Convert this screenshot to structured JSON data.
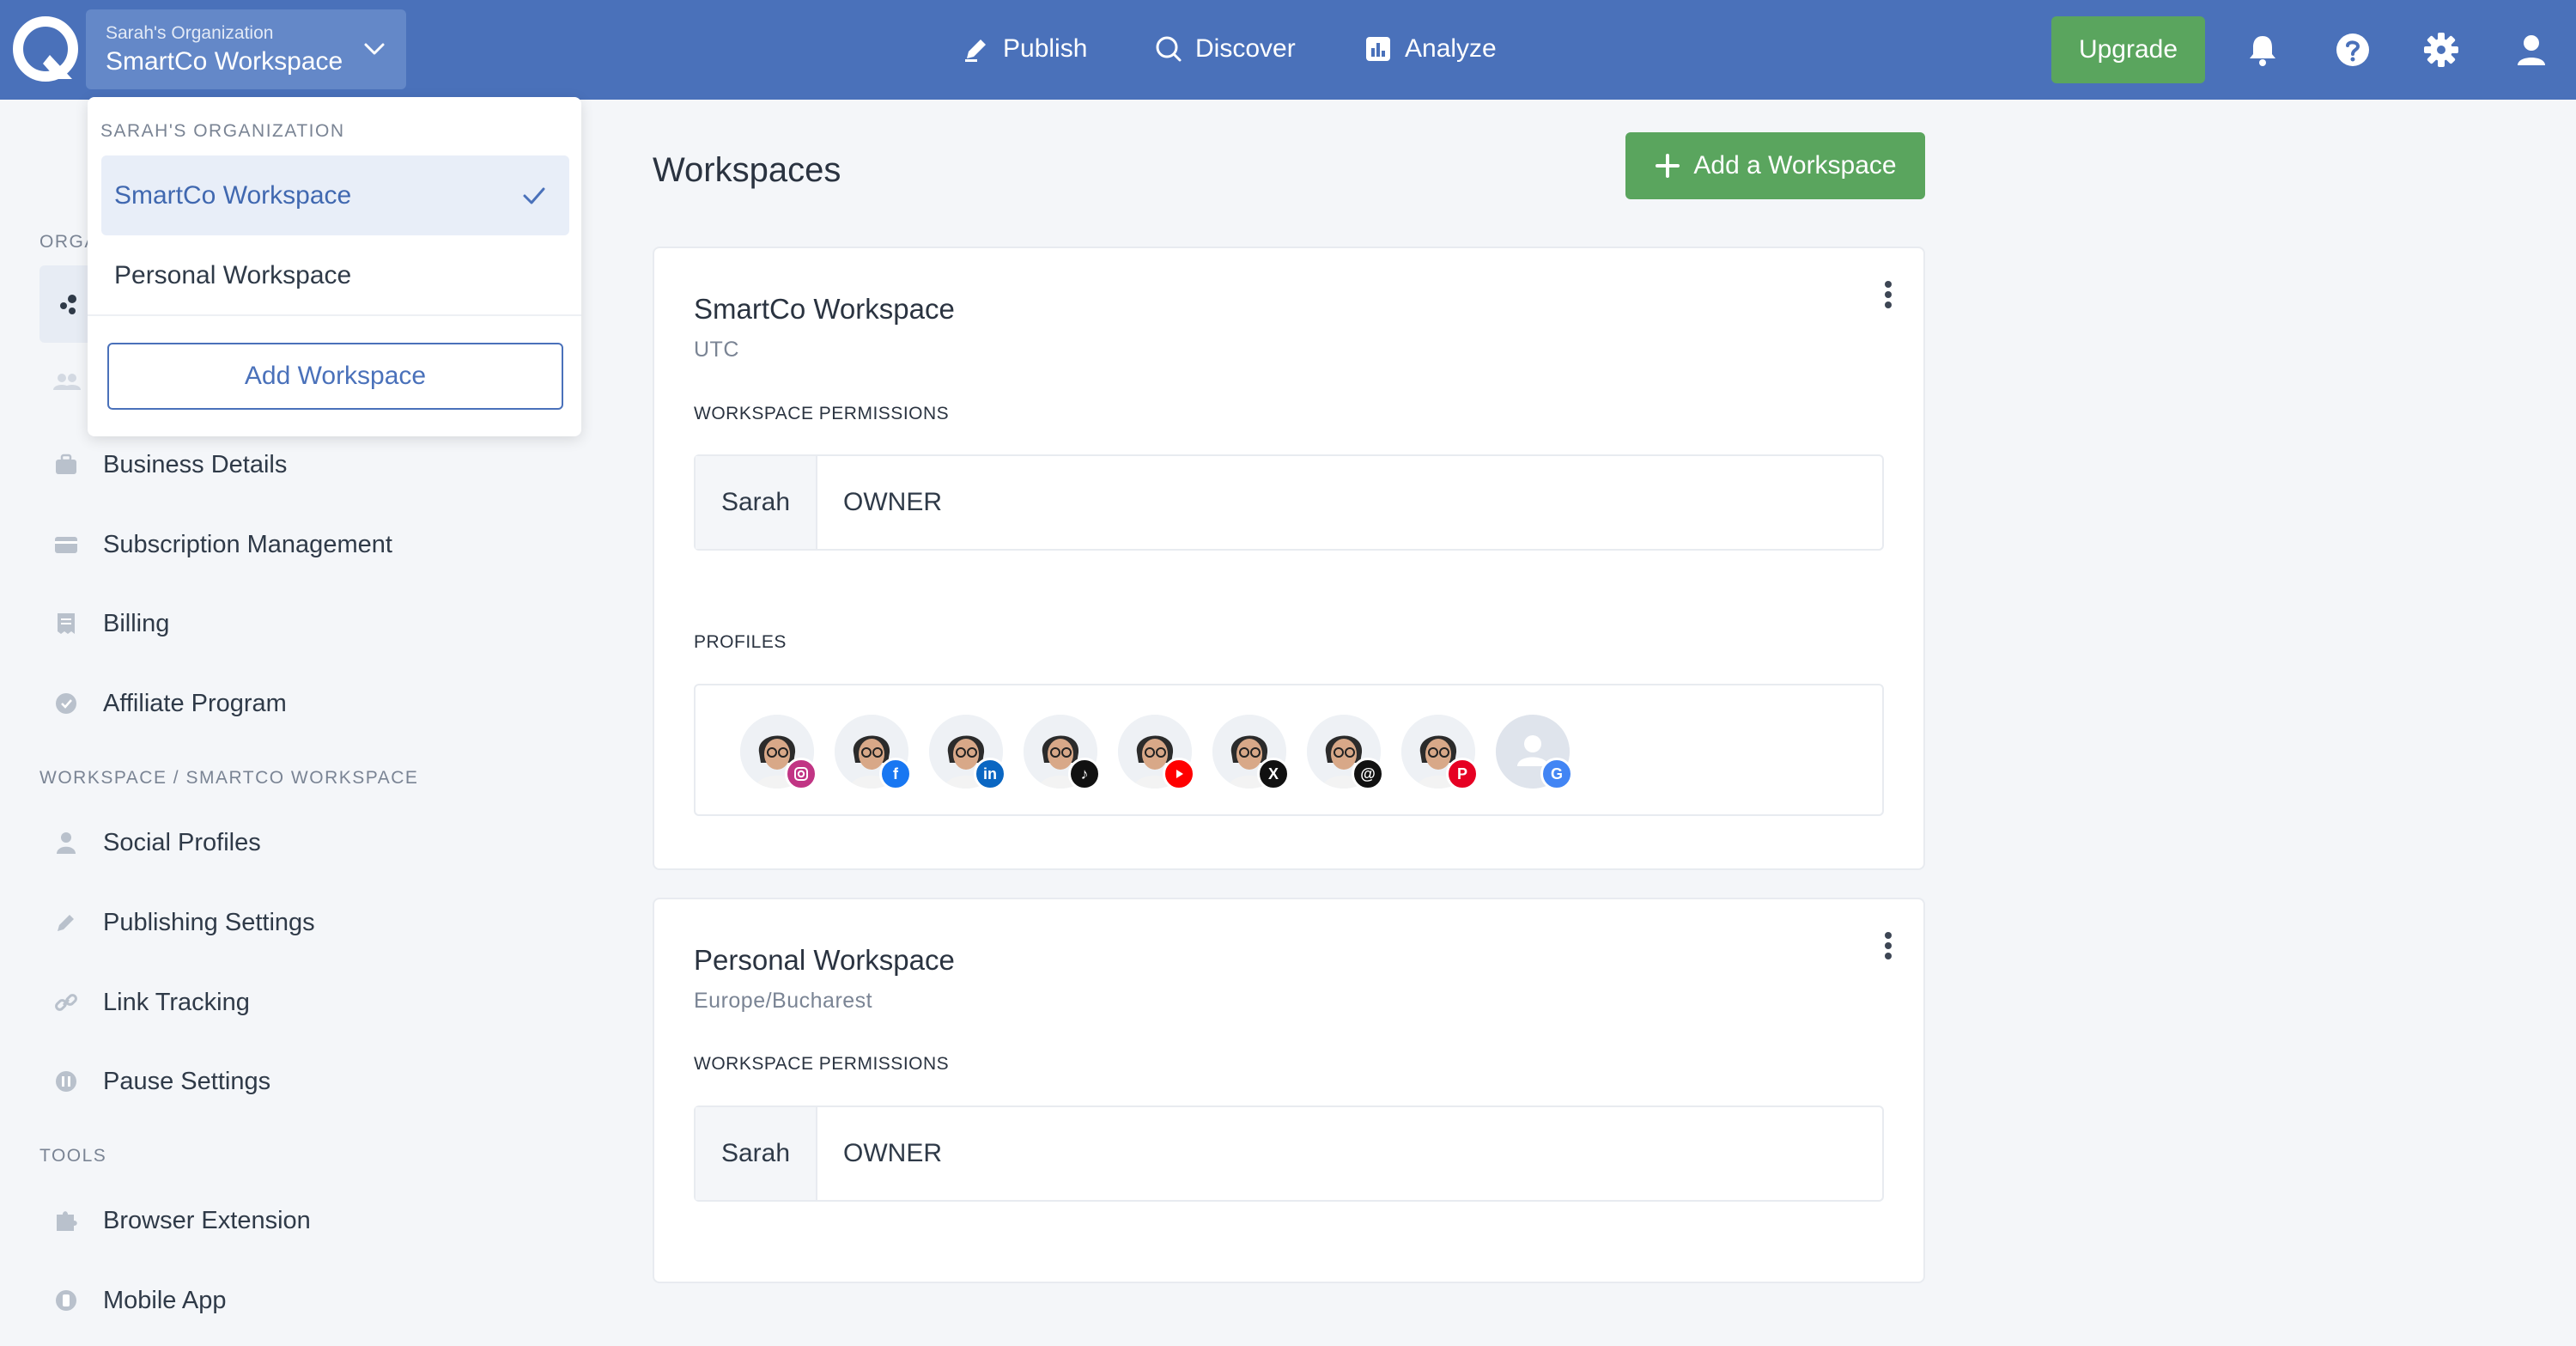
{
  "header": {
    "org_label": "Sarah's Organization",
    "workspace_label": "SmartCo Workspace",
    "nav": [
      {
        "label": "Publish",
        "icon": "pencil-icon"
      },
      {
        "label": "Discover",
        "icon": "search-icon"
      },
      {
        "label": "Analyze",
        "icon": "chart-icon"
      }
    ],
    "upgrade_label": "Upgrade",
    "icons": [
      "bell-icon",
      "help-icon",
      "gear-icon",
      "user-icon"
    ]
  },
  "dropdown": {
    "section_label": "SARAH'S ORGANIZATION",
    "items": [
      {
        "label": "SmartCo Workspace",
        "selected": true
      },
      {
        "label": "Personal Workspace",
        "selected": false
      }
    ],
    "add_label": "Add Workspace"
  },
  "sidebar": {
    "org_section_label": "ORGA",
    "org_items": [
      {
        "label": "Business Details",
        "icon": "briefcase-icon"
      },
      {
        "label": "Subscription Management",
        "icon": "card-icon"
      },
      {
        "label": "Billing",
        "icon": "receipt-icon"
      },
      {
        "label": "Affiliate Program",
        "icon": "badge-icon"
      }
    ],
    "workspace_section_label": "WORKSPACE / SMARTCO WORKSPACE",
    "workspace_items": [
      {
        "label": "Social Profiles",
        "icon": "person-icon"
      },
      {
        "label": "Publishing Settings",
        "icon": "pencil-icon"
      },
      {
        "label": "Link Tracking",
        "icon": "link-icon"
      },
      {
        "label": "Pause Settings",
        "icon": "pause-icon"
      }
    ],
    "tools_section_label": "TOOLS",
    "tools_items": [
      {
        "label": "Browser Extension",
        "icon": "puzzle-icon"
      },
      {
        "label": "Mobile App",
        "icon": "phone-icon"
      }
    ]
  },
  "main": {
    "title": "Workspaces",
    "add_button_label": "Add a Workspace",
    "workspaces": [
      {
        "name": "SmartCo Workspace",
        "timezone": "UTC",
        "permissions_label": "WORKSPACE PERMISSIONS",
        "permissions": [
          {
            "user": "Sarah",
            "role": "OWNER"
          }
        ],
        "profiles_label": "PROFILES",
        "profiles": [
          {
            "network": "instagram",
            "color": "#c13584"
          },
          {
            "network": "facebook",
            "color": "#1877f2"
          },
          {
            "network": "linkedin",
            "color": "#0a66c2"
          },
          {
            "network": "tiktok",
            "color": "#111111"
          },
          {
            "network": "youtube",
            "color": "#ff0000"
          },
          {
            "network": "x",
            "color": "#111111"
          },
          {
            "network": "threads",
            "color": "#111111"
          },
          {
            "network": "pinterest",
            "color": "#e60023"
          },
          {
            "network": "google-business",
            "color": "#4285f4"
          }
        ]
      },
      {
        "name": "Personal Workspace",
        "timezone": "Europe/Bucharest",
        "permissions_label": "WORKSPACE PERMISSIONS",
        "permissions": [
          {
            "user": "Sarah",
            "role": "OWNER"
          }
        ]
      }
    ]
  },
  "colors": {
    "header_bg": "#4a71ba",
    "accent_green": "#5aa55e",
    "selected_bg": "#e8eef8",
    "selected_text": "#4068b0"
  }
}
